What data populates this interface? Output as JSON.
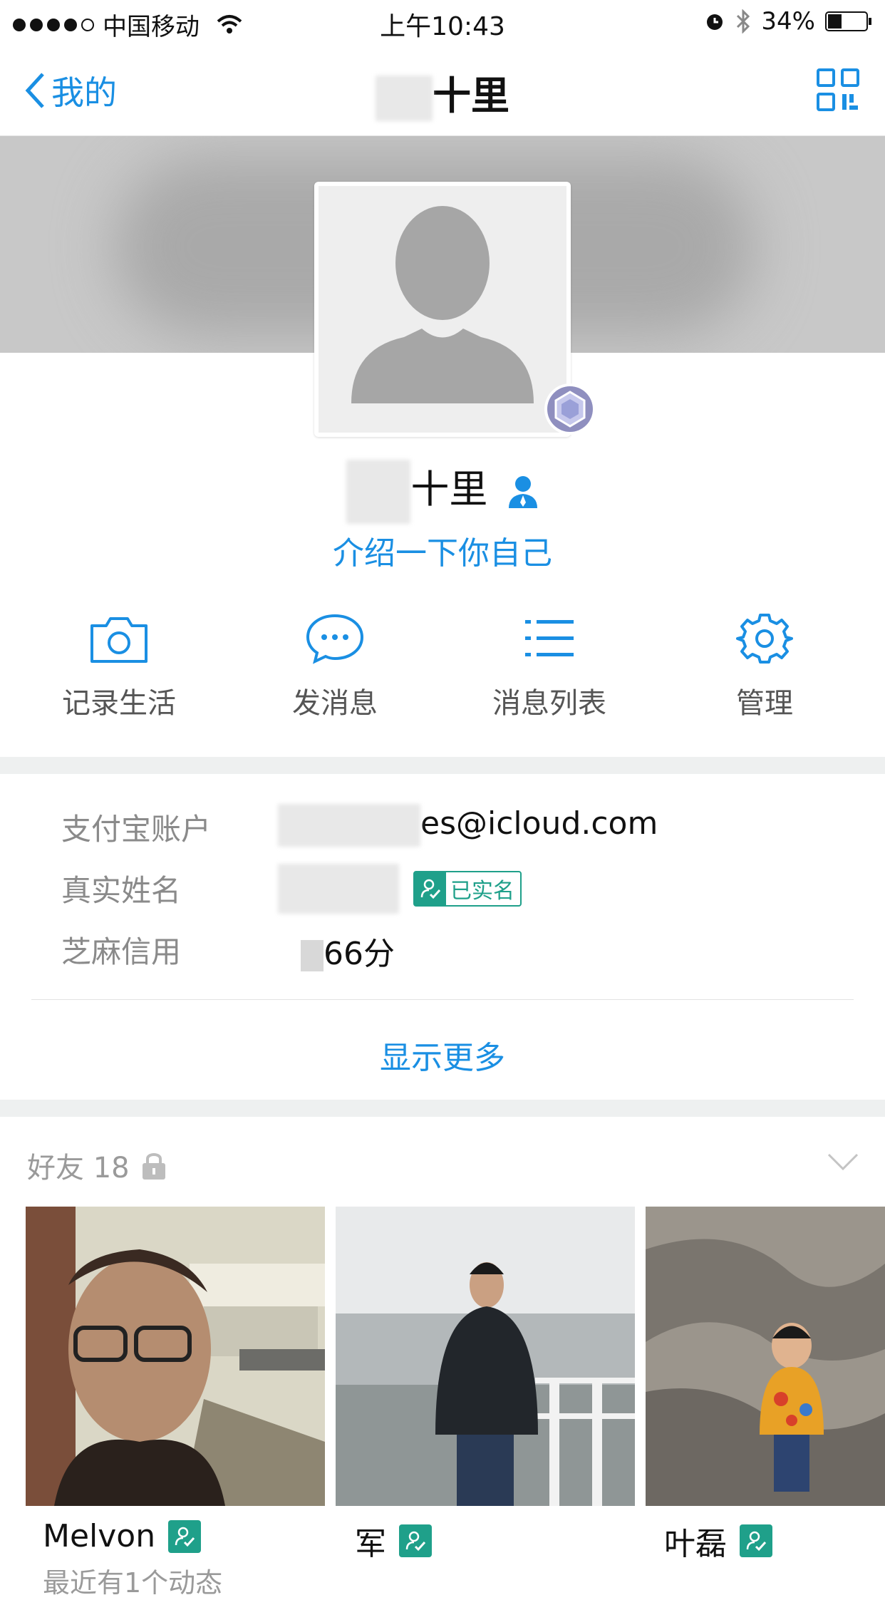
{
  "status": {
    "carrier": "中国移动",
    "time": "上午10:43",
    "battery": "34%"
  },
  "nav": {
    "back_label": "我的",
    "title_visible": "十里"
  },
  "profile": {
    "name_visible": "十里",
    "intro": "介绍一下你自己"
  },
  "actions": [
    {
      "label": "记录生活",
      "icon": "camera-icon"
    },
    {
      "label": "发消息",
      "icon": "chat-bubble-icon"
    },
    {
      "label": "消息列表",
      "icon": "list-icon"
    },
    {
      "label": "管理",
      "icon": "gear-icon"
    }
  ],
  "info": {
    "account_label": "支付宝账户",
    "account_value": "es@icloud.com",
    "realname_label": "真实姓名",
    "verified_text": "已实名",
    "credit_label": "芝麻信用",
    "credit_value": "66分"
  },
  "show_more": "显示更多",
  "friends": {
    "title": "好友 18",
    "items": [
      {
        "name": "Melvon",
        "note": "最近有1个动态"
      },
      {
        "name": "军"
      },
      {
        "name": "叶磊"
      }
    ]
  },
  "colors": {
    "accent": "#1a8fe3",
    "verified": "#1fa08a",
    "separator": "#eef0f0"
  }
}
